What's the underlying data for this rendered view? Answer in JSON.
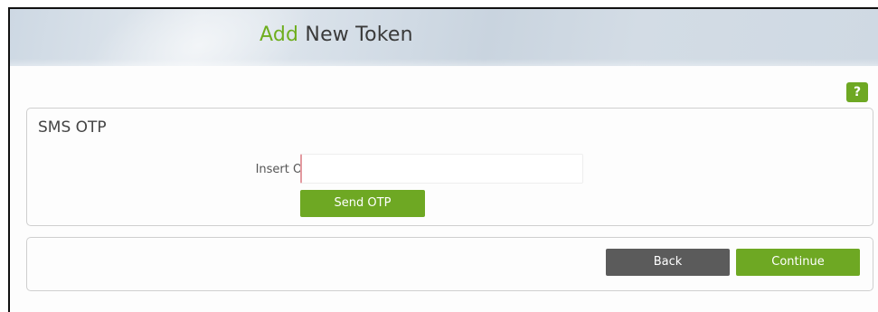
{
  "header": {
    "title_accent": "Add",
    "title_rest": "New Token"
  },
  "help": {
    "label": "?"
  },
  "sms_panel": {
    "title": "SMS OTP",
    "otp_label": "Insert OTP",
    "otp_value": "",
    "otp_placeholder": "",
    "send_button": "Send OTP"
  },
  "actions": {
    "back_button": "Back",
    "continue_button": "Continue"
  },
  "colors": {
    "accent_green": "#6ea823",
    "back_gray": "#5b5b5b",
    "input_focus_border": "#e39aa0"
  }
}
